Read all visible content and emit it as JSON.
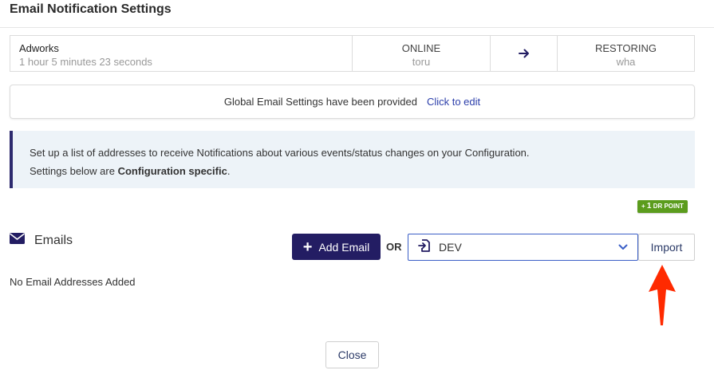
{
  "header": {
    "title": "Email Notification Settings"
  },
  "status_bar": {
    "name": "Adworks",
    "duration": "1 hour 5 minutes 23 seconds",
    "source_state": "ONLINE",
    "source_host": "toru",
    "arrow_icon": "arrow-right-icon",
    "target_state": "RESTORING",
    "target_host": "wha"
  },
  "global_settings": {
    "text": "Global Email Settings have been provided",
    "link": "Click to edit"
  },
  "info": {
    "line1": "Set up a list of addresses to receive Notifications about various events/status changes on your Configuration.",
    "line2_prefix": "Settings below are ",
    "line2_bold": "Configuration specific",
    "line2_suffix": "."
  },
  "badge": {
    "prefix": "+ ",
    "number": "1",
    "label": " DR POINT",
    "color": "#5b9c1d"
  },
  "emails": {
    "icon": "envelope-icon",
    "label": "Emails",
    "add_button_label": "Add Email",
    "or_label": "OR",
    "select_value": "DEV",
    "select_icon": "import-doc-icon",
    "import_label": "Import",
    "empty_text": "No Email Addresses Added"
  },
  "footer": {
    "close_label": "Close"
  },
  "colors": {
    "primary": "#231d63",
    "link": "#2b3eaa",
    "info_bg": "#edf3f8",
    "annotation": "#ff2a00"
  }
}
